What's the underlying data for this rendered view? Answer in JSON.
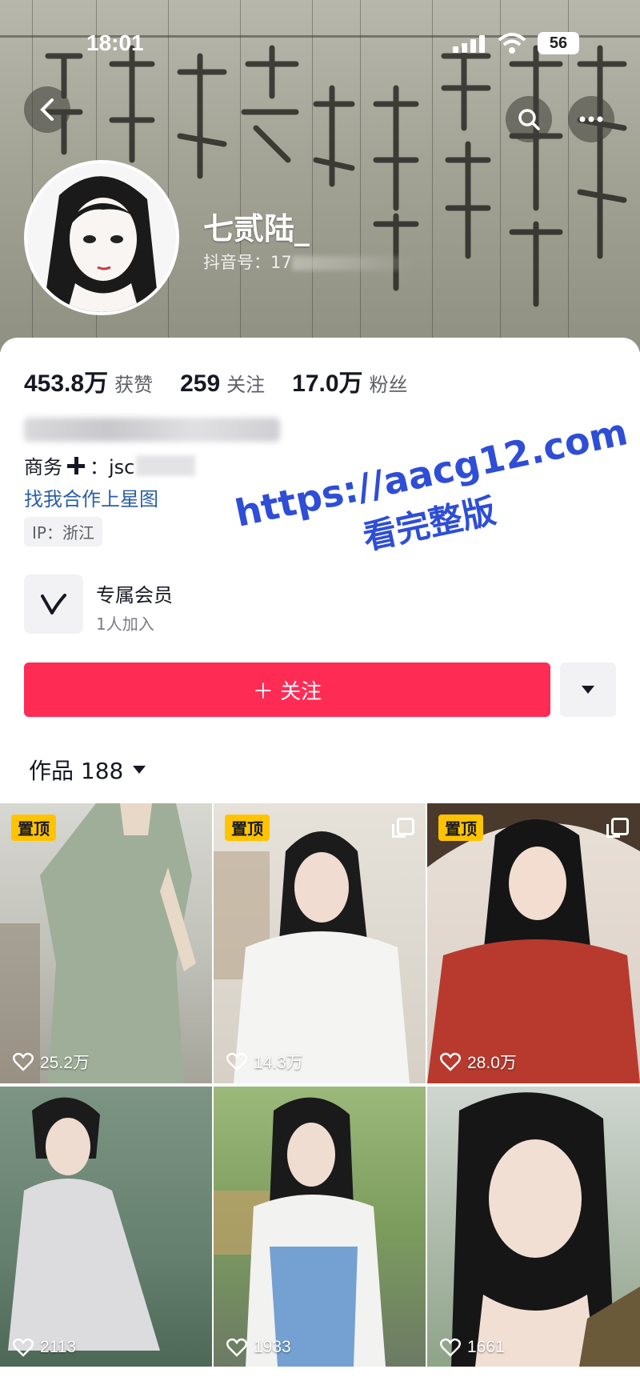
{
  "status_bar": {
    "time": "18:01",
    "battery": "56"
  },
  "header": {
    "username": "七贰陆_",
    "douyin_id_label": "抖音号：17"
  },
  "stats": [
    {
      "value": "453.8万",
      "label": "获赞"
    },
    {
      "value": "259",
      "label": "关注"
    },
    {
      "value": "17.0万",
      "label": "粉丝"
    }
  ],
  "profile": {
    "business_label": "商务",
    "business_value": "：jsc",
    "star_link": "找我合作上星图",
    "ip_tag": "IP：浙江"
  },
  "membership": {
    "title": "专属会员",
    "subtitle": "1人加入"
  },
  "actions": {
    "follow_label": "＋ 关注"
  },
  "works": {
    "label": "作品 188"
  },
  "grid": [
    {
      "likes": "25.2万",
      "pinned": "置顶",
      "multi": false
    },
    {
      "likes": "14.3万",
      "pinned": "置顶",
      "multi": true
    },
    {
      "likes": "28.0万",
      "pinned": "置顶",
      "multi": true
    },
    {
      "likes": "2113"
    },
    {
      "likes": "1933"
    },
    {
      "likes": "1661"
    }
  ],
  "watermark": {
    "url": "https://aacg12.com",
    "sub": "看完整版"
  },
  "colors": {
    "accent": "#fe2c55",
    "link": "#2a5ea8",
    "pin": "#ffc300",
    "watermark": "#2f4ed6"
  }
}
